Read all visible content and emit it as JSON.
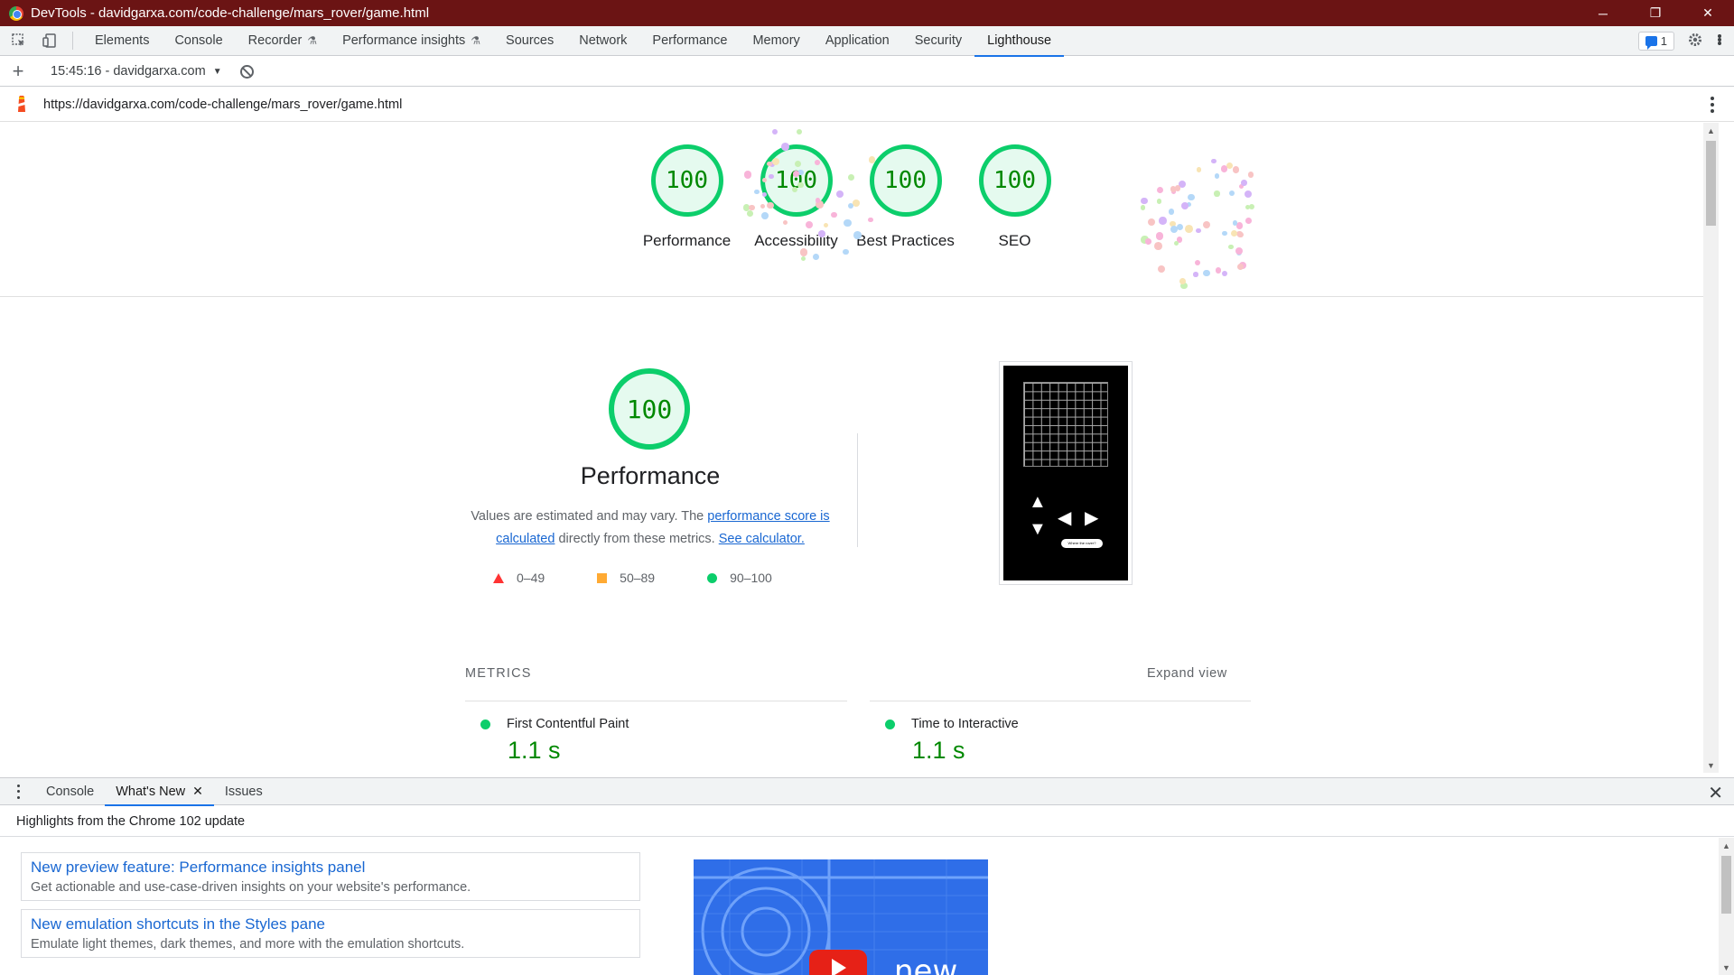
{
  "window": {
    "title": "DevTools - davidgarxa.com/code-challenge/mars_rover/game.html",
    "controls": [
      "─",
      "❐",
      "✕"
    ]
  },
  "devtools_tabs": [
    {
      "label": "Elements",
      "experimental": false
    },
    {
      "label": "Console",
      "experimental": false
    },
    {
      "label": "Recorder",
      "experimental": true
    },
    {
      "label": "Performance insights",
      "experimental": true
    },
    {
      "label": "Sources",
      "experimental": false
    },
    {
      "label": "Network",
      "experimental": false
    },
    {
      "label": "Performance",
      "experimental": false
    },
    {
      "label": "Memory",
      "experimental": false
    },
    {
      "label": "Application",
      "experimental": false
    },
    {
      "label": "Security",
      "experimental": false
    },
    {
      "label": "Lighthouse",
      "experimental": false,
      "active": true
    }
  ],
  "issues_count": "1",
  "lighthouse_toolbar": {
    "add_label": "+",
    "report_select": "15:45:16 - davidgarxa.com"
  },
  "report_url": "https://davidgarxa.com/code-challenge/mars_rover/game.html",
  "summary_gauges": [
    {
      "score": "100",
      "label": "Performance"
    },
    {
      "score": "100",
      "label": "Accessibility"
    },
    {
      "score": "100",
      "label": "Best Practices"
    },
    {
      "score": "100",
      "label": "SEO"
    }
  ],
  "performance": {
    "score": "100",
    "title": "Performance",
    "desc_prefix": "Values are estimated and may vary. The ",
    "desc_link1": "performance score is calculated",
    "desc_middle": " directly from these metrics. ",
    "desc_link2": "See calculator.",
    "legend": [
      "0–49",
      "50–89",
      "90–100"
    ],
    "screenshot_caption": "Where the rover?"
  },
  "metrics": {
    "header": "METRICS",
    "expand": "Expand view",
    "items": [
      {
        "name": "First Contentful Paint",
        "value": "1.1 s"
      },
      {
        "name": "Time to Interactive",
        "value": "1.1 s"
      }
    ]
  },
  "drawer": {
    "tabs": [
      "Console",
      "What's New",
      "Issues"
    ],
    "active_tab": "What's New",
    "subtitle": "Highlights from the Chrome 102 update",
    "cards": [
      {
        "title": "New preview feature: Performance insights panel",
        "desc": "Get actionable and use-case-driven insights on your website's performance."
      },
      {
        "title": "New emulation shortcuts in the Styles pane",
        "desc": "Emulate light themes, dark themes, and more with the emulation shortcuts."
      }
    ],
    "video_text": "new"
  },
  "colors": {
    "title_bar": "#6b1414",
    "pass_green": "#0cce6b",
    "score_text": "#008800",
    "link_blue": "#1967d2",
    "tab_underline": "#1a73e8"
  }
}
